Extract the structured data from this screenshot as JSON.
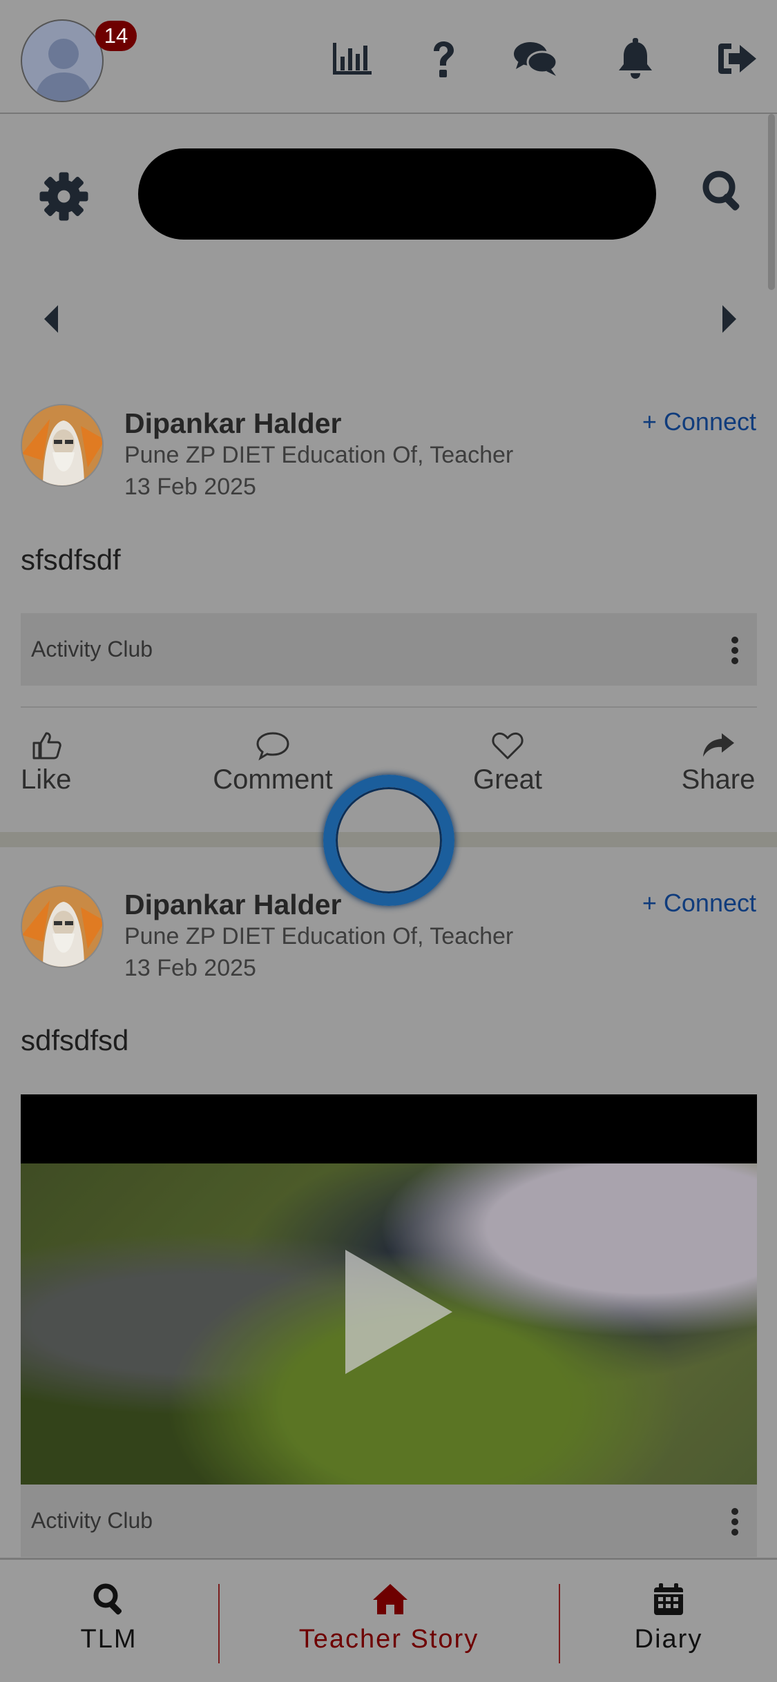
{
  "header": {
    "notification_count": "14",
    "icons": [
      "bar-chart-icon",
      "help-icon",
      "chat-icon",
      "bell-icon",
      "logout-icon"
    ]
  },
  "search": {
    "placeholder": ""
  },
  "posts": [
    {
      "author": "Dipankar Halder",
      "subtitle": "Pune ZP DIET Education Of, Teacher",
      "date": "13 Feb 2025",
      "connect_label": "+ Connect",
      "text": "sfsdfsdf",
      "club": "Activity Club",
      "actions": {
        "like": "Like",
        "comment": "Comment",
        "great": "Great",
        "share": "Share"
      }
    },
    {
      "author": "Dipankar Halder",
      "subtitle": "Pune ZP DIET Education Of, Teacher",
      "date": "13 Feb 2025",
      "connect_label": "+ Connect",
      "text": "sdfsdfsd",
      "club": "Activity Club"
    }
  ],
  "bottom_nav": {
    "items": [
      {
        "label": "TLM",
        "icon": "search-icon"
      },
      {
        "label": "Teacher Story",
        "icon": "home-icon",
        "active": true
      },
      {
        "label": "Diary",
        "icon": "calendar-icon"
      }
    ]
  },
  "colors": {
    "accent": "#6e0000",
    "link": "#103c7c",
    "overlay": "#9a9a9a"
  }
}
